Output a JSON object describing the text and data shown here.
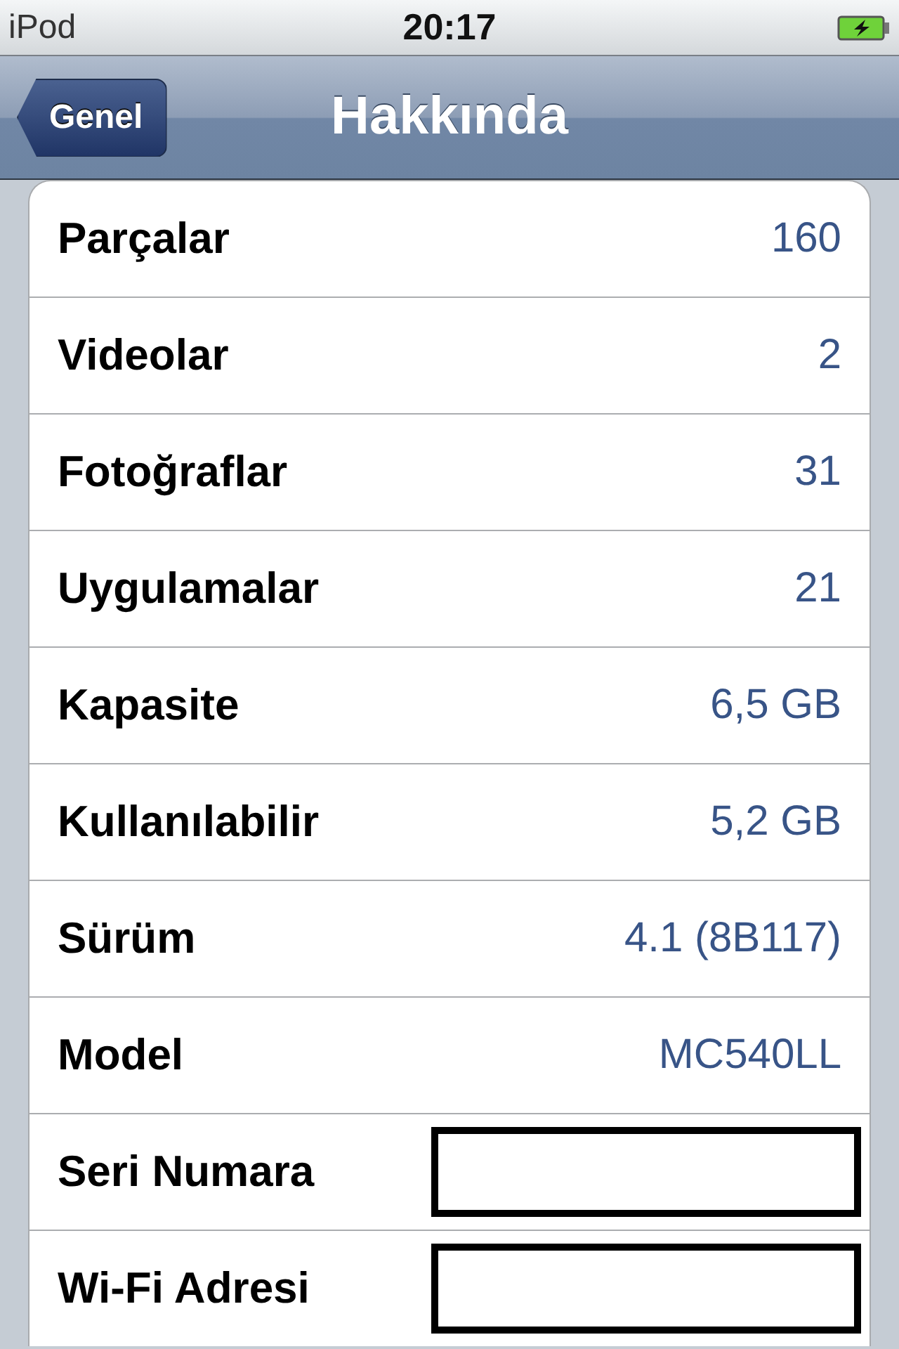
{
  "status_bar": {
    "carrier": "iPod",
    "time": "20:17"
  },
  "nav_bar": {
    "back_button": "Genel",
    "title": "Hakkında"
  },
  "rows": [
    {
      "label": "Parçalar",
      "kind": "value",
      "value": "160"
    },
    {
      "label": "Videolar",
      "kind": "value",
      "value": "2"
    },
    {
      "label": "Fotoğraflar",
      "kind": "value",
      "value": "31"
    },
    {
      "label": "Uygulamalar",
      "kind": "value",
      "value": "21"
    },
    {
      "label": "Kapasite",
      "kind": "value",
      "value": "6,5 GB"
    },
    {
      "label": "Kullanılabilir",
      "kind": "value",
      "value": "5,2 GB"
    },
    {
      "label": "Sürüm",
      "kind": "value",
      "value": "4.1 (8B117)"
    },
    {
      "label": "Model",
      "kind": "value",
      "value": "MC540LL"
    },
    {
      "label": "Seri Numara",
      "kind": "redacted"
    },
    {
      "label": "Wi-Fi Adresi",
      "kind": "redacted"
    }
  ]
}
